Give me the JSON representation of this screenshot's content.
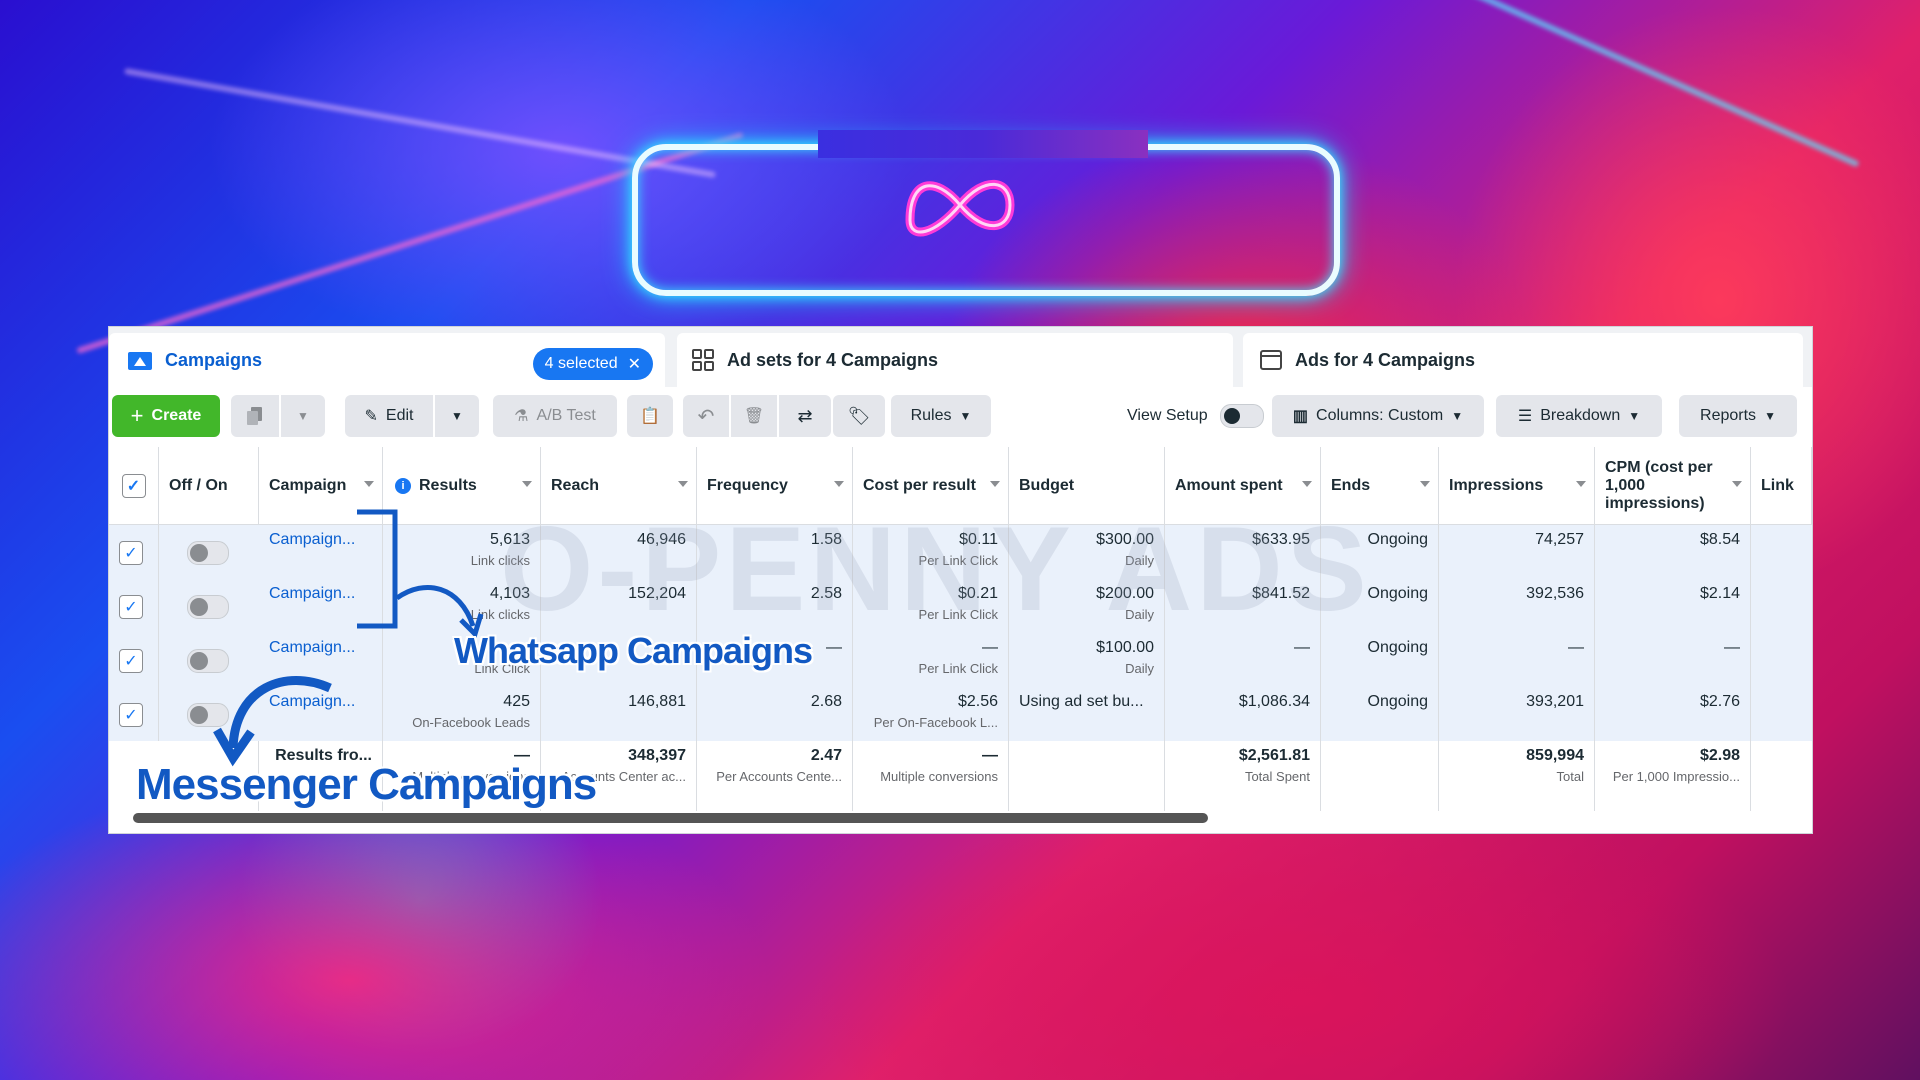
{
  "colors": {
    "brand": "#1877f2",
    "create": "#42b72a",
    "link": "#0a5fd0",
    "annotation": "#1259c3",
    "neon_cyan": "#39e6ff",
    "neon_magenta": "#ff3ad8"
  },
  "tabs": [
    {
      "label": "Campaigns",
      "icon": "campaign-folder-icon",
      "badge": "4 selected"
    },
    {
      "label": "Ad sets for 4 Campaigns",
      "icon": "grid-icon"
    },
    {
      "label": "Ads for 4 Campaigns",
      "icon": "ad-square-icon"
    }
  ],
  "toolbar": {
    "create": "Create",
    "edit": "Edit",
    "ab_test": "A/B Test",
    "rules": "Rules",
    "view_setup": "View Setup",
    "columns": "Columns: Custom",
    "breakdown": "Breakdown",
    "reports": "Reports"
  },
  "columns": [
    "Off / On",
    "Campaign",
    "Results",
    "Reach",
    "Frequency",
    "Cost per result",
    "Budget",
    "Amount spent",
    "Ends",
    "Impressions",
    "CPM (cost per 1,000 impressions)",
    "Link"
  ],
  "rows": [
    {
      "campaign": "Campaign...",
      "results": "5,613",
      "results_sub": "Link clicks",
      "reach": "46,946",
      "frequency": "1.58",
      "cpr": "$0.11",
      "cpr_sub": "Per Link Click",
      "budget": "$300.00",
      "budget_sub": "Daily",
      "spent": "$633.95",
      "ends": "Ongoing",
      "impressions": "74,257",
      "cpm": "$8.54"
    },
    {
      "campaign": "Campaign...",
      "results": "4,103",
      "results_sub": "Link clicks",
      "reach": "152,204",
      "frequency": "2.58",
      "cpr": "$0.21",
      "cpr_sub": "Per Link Click",
      "budget": "$200.00",
      "budget_sub": "Daily",
      "spent": "$841.52",
      "ends": "Ongoing",
      "impressions": "392,536",
      "cpm": "$2.14"
    },
    {
      "campaign": "Campaign...",
      "results": "—",
      "results_sub": "Link Click",
      "reach": "—",
      "frequency": "—",
      "cpr": "—",
      "cpr_sub": "Per Link Click",
      "budget": "$100.00",
      "budget_sub": "Daily",
      "spent": "—",
      "ends": "Ongoing",
      "impressions": "—",
      "cpm": "—"
    },
    {
      "campaign": "Campaign...",
      "results": "425",
      "results_sub": "On-Facebook Leads",
      "reach": "146,881",
      "frequency": "2.68",
      "cpr": "$2.56",
      "cpr_sub": "Per On-Facebook L...",
      "budget": "Using ad set bu...",
      "budget_sub": "",
      "spent": "$1,086.34",
      "ends": "Ongoing",
      "impressions": "393,201",
      "cpm": "$2.76"
    }
  ],
  "totals": {
    "label": "Results fro...",
    "results": "—",
    "results_sub": "Multiple conversions",
    "reach": "348,397",
    "reach_sub": "Accounts Center ac...",
    "frequency": "2.47",
    "frequency_sub": "Per Accounts Cente...",
    "cpr": "—",
    "cpr_sub": "Multiple conversions",
    "spent": "$2,561.81",
    "spent_sub": "Total Spent",
    "impressions": "859,994",
    "impressions_sub": "Total",
    "cpm": "$2.98",
    "cpm_sub": "Per 1,000 Impressio..."
  },
  "watermark": "O-PENNY ADS",
  "annotations": {
    "whatsapp": "Whatsapp Campaigns",
    "messenger": "Messenger Campaigns"
  }
}
